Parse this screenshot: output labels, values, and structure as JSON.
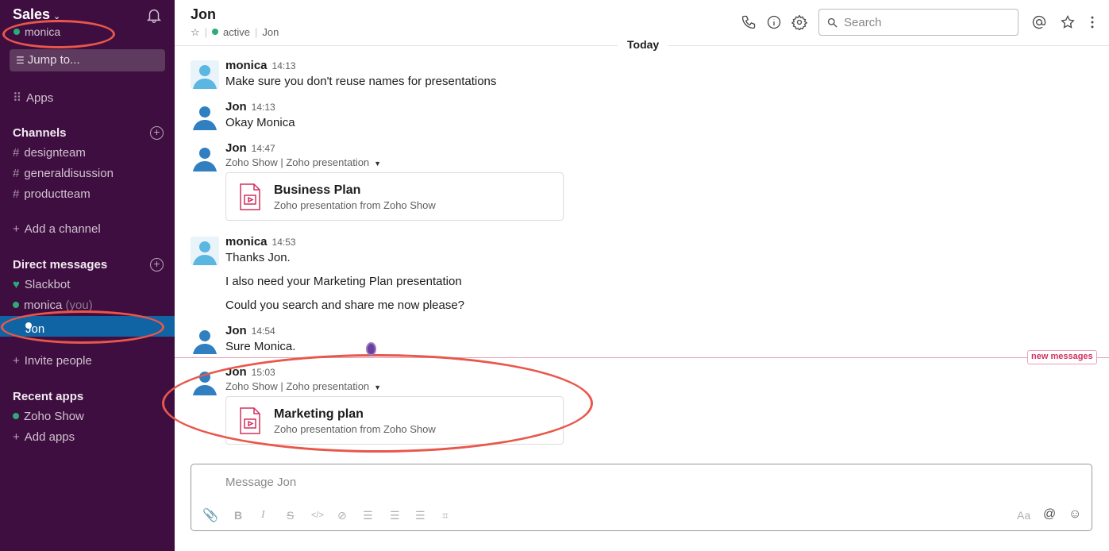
{
  "sidebar": {
    "workspace": "Sales",
    "user": "monica",
    "jump": "Jump to...",
    "apps": "Apps",
    "channels_head": "Channels",
    "channels": [
      "designteam",
      "generaldisussion",
      "productteam"
    ],
    "add_channel": "Add a channel",
    "dm_head": "Direct messages",
    "dm_slackbot": "Slackbot",
    "dm_monica": "monica",
    "dm_you": "(you)",
    "dm_jon": "Jon",
    "invite": "Invite people",
    "recent_head": "Recent apps",
    "recent_app": "Zoho Show",
    "add_apps": "Add apps"
  },
  "header": {
    "title": "Jon",
    "status": "active",
    "name": "Jon",
    "search_placeholder": "Search"
  },
  "today": "Today",
  "messages": [
    {
      "name": "monica",
      "time": "14:13",
      "text": "Make sure you don't reuse names for presentations"
    },
    {
      "name": "Jon",
      "time": "14:13",
      "text": "Okay Monica"
    },
    {
      "name": "Jon",
      "time": "14:47",
      "sub": "Zoho Show | Zoho presentation",
      "att_title": "Business Plan",
      "att_sub": "Zoho presentation from Zoho Show"
    },
    {
      "name": "monica",
      "time": "14:53",
      "text": "Thanks Jon.",
      "text2": "I also need your Marketing Plan presentation",
      "text3": "Could you search and share me now please?"
    },
    {
      "name": "Jon",
      "time": "14:54",
      "text": "Sure Monica."
    },
    {
      "name": "Jon",
      "time": "15:03",
      "sub": "Zoho Show | Zoho presentation",
      "att_title": "Marketing plan",
      "att_sub": "Zoho presentation from Zoho Show"
    }
  ],
  "new_messages": "new messages",
  "composer": {
    "placeholder": "Message Jon",
    "format_label": "Aa"
  },
  "colors": {
    "sidebar": "#3f0e40",
    "active": "#1164a3",
    "online": "#2bac76",
    "annotation": "#e8574a"
  }
}
